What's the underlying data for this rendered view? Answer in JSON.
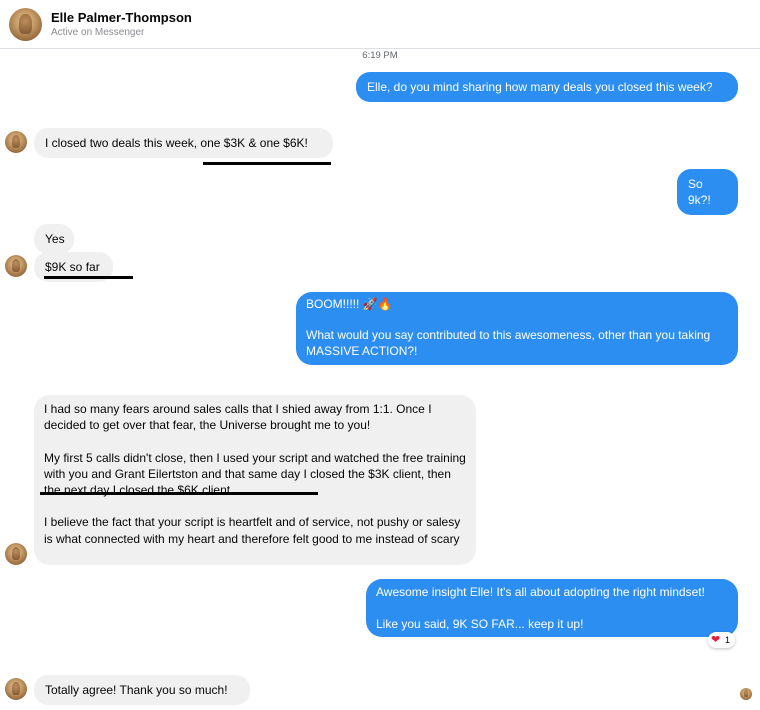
{
  "header": {
    "name": "Elle Palmer-Thompson",
    "status": "Active on Messenger"
  },
  "timestamp": "6:19 PM",
  "messages": [
    {
      "from": "me",
      "text": "Elle, do you mind sharing how many deals you closed this week?"
    },
    {
      "from": "them",
      "text": "I closed two deals this week, one $3K & one $6K!"
    },
    {
      "from": "me",
      "text": "So 9k?!"
    },
    {
      "from": "them",
      "text": "Yes"
    },
    {
      "from": "them",
      "text": "$9K so far"
    },
    {
      "from": "me",
      "text": "BOOM!!!!! 🚀🔥\n\nWhat would you say contributed to this awesomeness, other than you taking MASSIVE ACTION?!"
    },
    {
      "from": "them",
      "text": "I had so many fears around sales calls that I shied away from 1:1. Once I decided to get over that fear, the Universe brought me to you!\n\nMy first 5 calls didn't close, then I used your script and watched the free training with you and Grant Eilertston and that same day I closed the $3K client, then the next day I closed the $6K client.\n\nI believe the fact that your script is heartfelt and of service, not pushy or salesy is what connected with my heart and therefore felt good to me instead of scary"
    },
    {
      "from": "me",
      "text": "Awesome insight Elle! It's all about adopting the right mindset!\n\nLike you said, 9K SO FAR... keep it up!"
    },
    {
      "from": "them",
      "text": "Totally agree!  Thank you so much!"
    }
  ],
  "reaction": {
    "icon": "heart-icon",
    "count": "1"
  },
  "colors": {
    "outgoing": "#2c8ef0",
    "incoming": "#f0f0f0"
  }
}
